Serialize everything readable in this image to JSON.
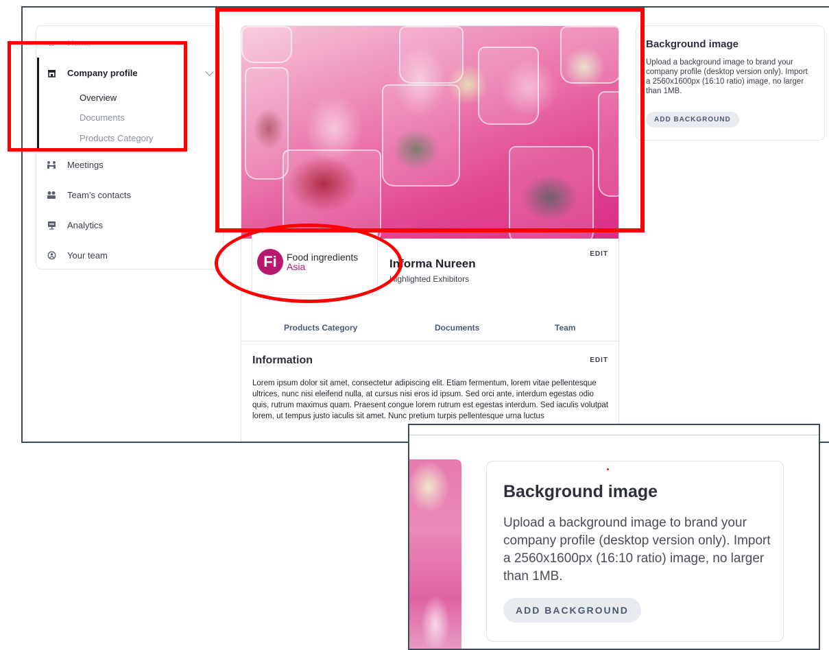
{
  "sidebar": {
    "home_label": "Home",
    "company_profile_label": "Company profile",
    "sub_items": [
      "Overview",
      "Documents",
      "Products Category"
    ],
    "meetings_label": "Meetings",
    "contacts_label": "Team’s contacts",
    "analytics_label": "Analytics",
    "your_team_label": "Your team"
  },
  "profile": {
    "logo": {
      "badge_text": "Fi",
      "line1": "Food ingredients",
      "line2": "Asia"
    },
    "company_name": "Informa Nureen",
    "company_subtitle": "Highlighted Exhibitors",
    "edit_label": "EDIT",
    "tabs": [
      "Products Category",
      "Documents",
      "Team"
    ],
    "information": {
      "title": "Information",
      "edit_label": "EDIT",
      "body": "Lorem ipsum dolor sit amet, consectetur adipiscing elit. Etiam fermentum, lorem vitae pellentesque ultrices, nunc nisi eleifend nulla, at cursus nisi eros id ipsum. Sed orci ante, interdum egestas odio quis, rutrum maximus quam. Praesent congue lorem rutrum est egestas interdum. Sed iaculis volutpat lorem, ut tempus justo iaculis sit amet. Nunc pretium turpis pellentesque urna luctus"
    }
  },
  "background_card": {
    "title": "Background image",
    "description": "Upload a background image to brand your company profile (desktop version only). Import a 2560x1600px (16:10 ratio) image, no larger than 1MB.",
    "button_label": "ADD BACKGROUND"
  },
  "colors": {
    "annotation": "#ff0000",
    "brand_magenta": "#b8186f",
    "frame_border": "#3d4a5c"
  },
  "icons": {
    "home": "home-icon",
    "company_profile": "storefront-icon",
    "meetings": "meeting-icon",
    "contacts": "contacts-icon",
    "analytics": "presentation-icon",
    "your_team": "team-icon"
  }
}
